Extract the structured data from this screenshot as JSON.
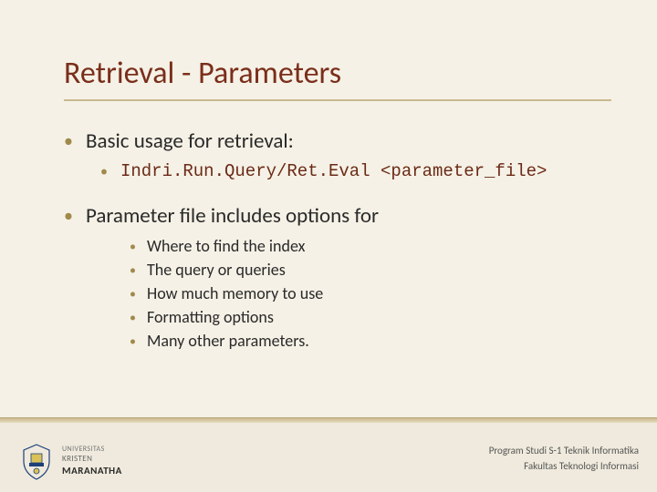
{
  "title": "Retrieval - Parameters",
  "bul1a": "Basic usage for retrieval:",
  "code_line": "Indri.Run.Query/Ret.Eval <parameter_file>",
  "bul1b": "Parameter file includes options for",
  "sub": {
    "a": "Where to find the index",
    "b": "The query or queries",
    "c": "How much memory to use",
    "d": "Formatting options",
    "e": "Many other parameters."
  },
  "footer": {
    "uni": "UNIVERSITAS",
    "kris": "KRISTEN",
    "mara": "MARANATHA",
    "prog": "Program Studi S-1 Teknik Informatika",
    "fak": "Fakultas Teknologi Informasi"
  }
}
